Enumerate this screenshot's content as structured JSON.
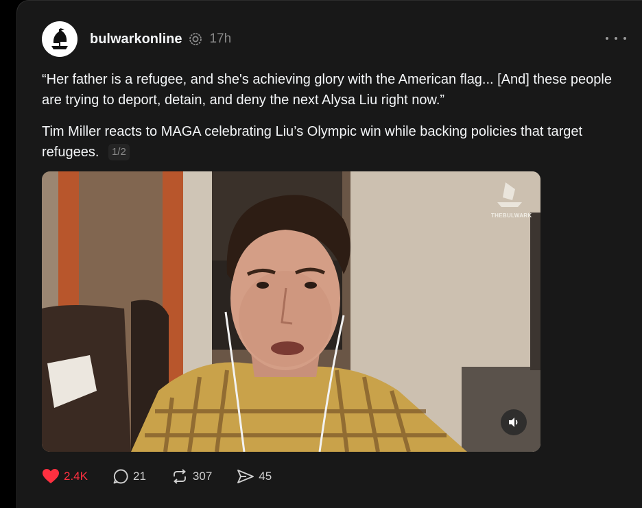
{
  "post": {
    "username": "bulwarkonline",
    "time": "17h",
    "quote": "“Her father is a refugee, and she's achieving glory with the American flag... [And] these people are trying to deport, detain, and deny the next Alysa Liu right now.”",
    "description": "Tim Miller reacts to MAGA celebrating Liu’s Olympic win while backing policies that target refugees.",
    "page_indicator": "1/2",
    "watermark": "THEBULWARK"
  },
  "actions": {
    "likes": "2.4K",
    "replies": "21",
    "reposts": "307",
    "shares": "45"
  },
  "colors": {
    "like": "#ff3040",
    "background": "#181818",
    "text": "#f3f5f7",
    "muted": "#8a8a8a"
  },
  "icons": [
    "ship-logo-icon",
    "verified-icon",
    "more-icon",
    "speaker-icon",
    "heart-icon",
    "reply-icon",
    "repost-icon",
    "share-icon"
  ]
}
